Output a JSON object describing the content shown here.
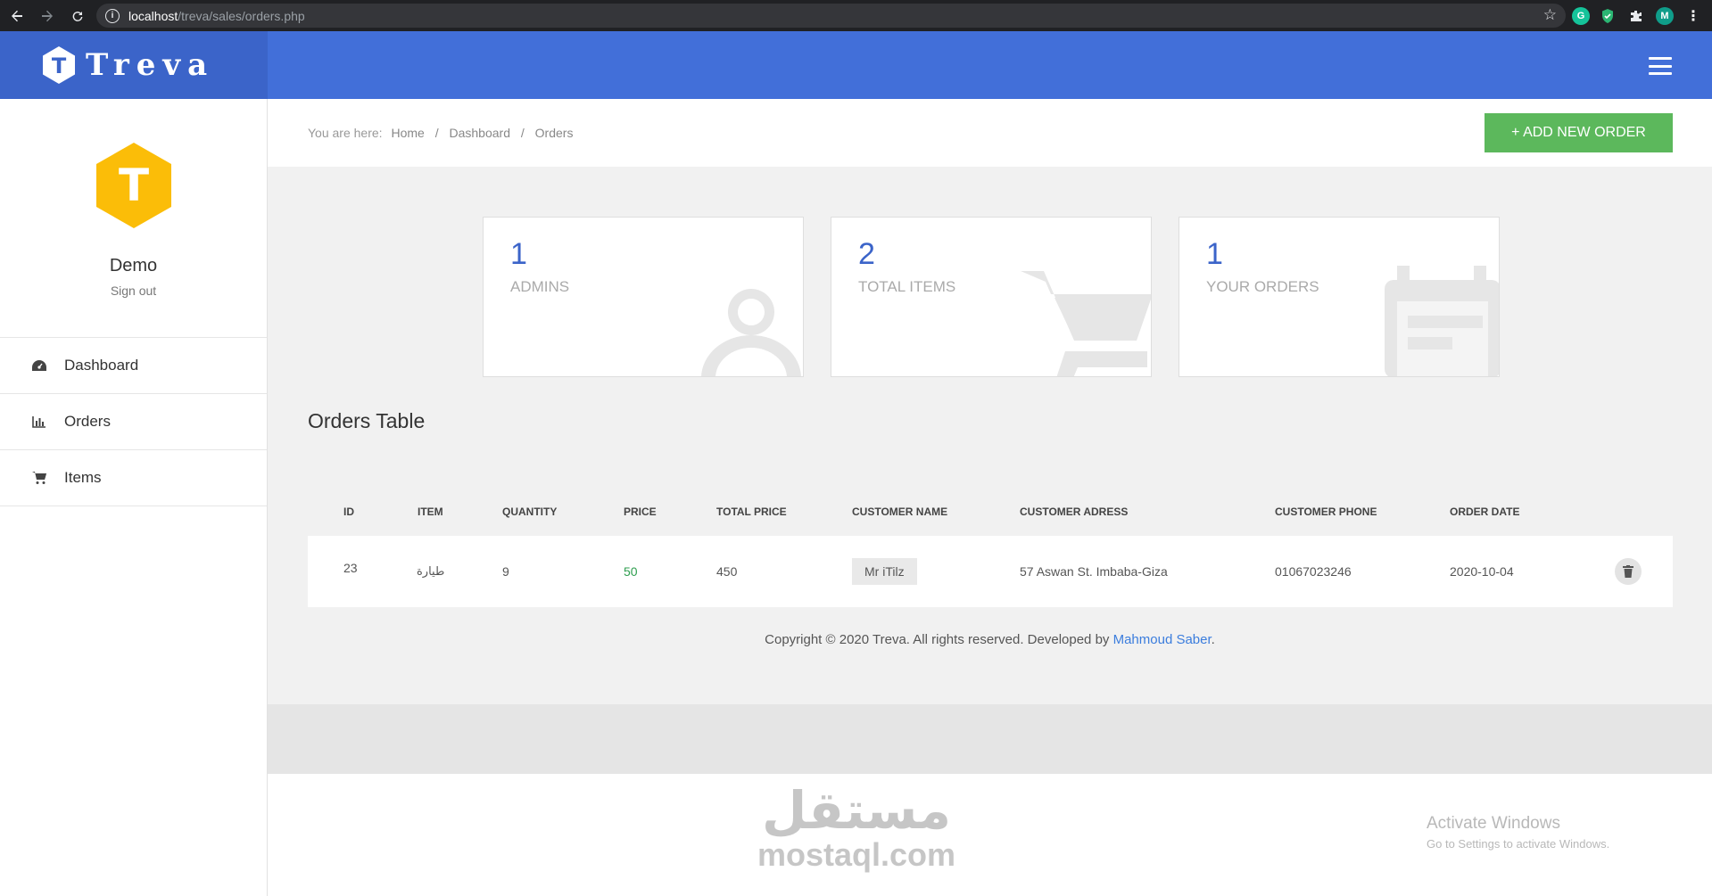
{
  "browser": {
    "url_host": "localhost",
    "url_path": "/treva/sales/orders.php",
    "avatar_letter": "M"
  },
  "brand": {
    "logo_letter": "T",
    "name": "Treva"
  },
  "profile": {
    "logo_letter": "T",
    "name": "Demo",
    "signout": "Sign out"
  },
  "sidebar": {
    "items": [
      {
        "label": "Dashboard",
        "icon": "dashboard-icon"
      },
      {
        "label": "Orders",
        "icon": "bar-chart-icon"
      },
      {
        "label": "Items",
        "icon": "cart-icon"
      }
    ]
  },
  "breadcrumb": {
    "prefix": "You are here:",
    "items": [
      "Home",
      "Dashboard",
      "Orders"
    ],
    "separator": "/"
  },
  "add_button": {
    "label": "+ ADD NEW ORDER"
  },
  "stats": [
    {
      "value": "1",
      "label": "ADMINS",
      "icon": "user-icon"
    },
    {
      "value": "2",
      "label": "TOTAL ITEMS",
      "icon": "cart-icon"
    },
    {
      "value": "1",
      "label": "YOUR ORDERS",
      "icon": "calendar-icon"
    }
  ],
  "table": {
    "title": "Orders Table",
    "columns": [
      "ID",
      "ITEM",
      "QUANTITY",
      "PRICE",
      "TOTAL PRICE",
      "CUSTOMER NAME",
      "CUSTOMER ADRESS",
      "CUSTOMER PHONE",
      "ORDER DATE"
    ],
    "rows": [
      {
        "id": "23",
        "item": "طيارة",
        "quantity": "9",
        "price": "50",
        "total": "450",
        "customer_name": "Mr iTilz",
        "address": "57 Aswan St. Imbaba-Giza",
        "phone": "01067023246",
        "date": "2020-10-04"
      }
    ]
  },
  "footer": {
    "copyright": "Copyright © 2020 Treva. All rights reserved. Developed by ",
    "author": "Mahmoud Saber",
    "end": "."
  },
  "os_watermark": {
    "line1": "Activate Windows",
    "line2": "Go to Settings to activate Windows."
  },
  "site_watermark": {
    "arabic": "مستقل",
    "latin": "mostaql.com"
  },
  "colors": {
    "brand_blue": "#3b64c9",
    "topbar_blue": "#426fd9",
    "profile_yellow": "#fbbd08",
    "add_green": "#5cb85c",
    "price_green": "#2e9e4f",
    "link_blue": "#3b7ddd"
  }
}
